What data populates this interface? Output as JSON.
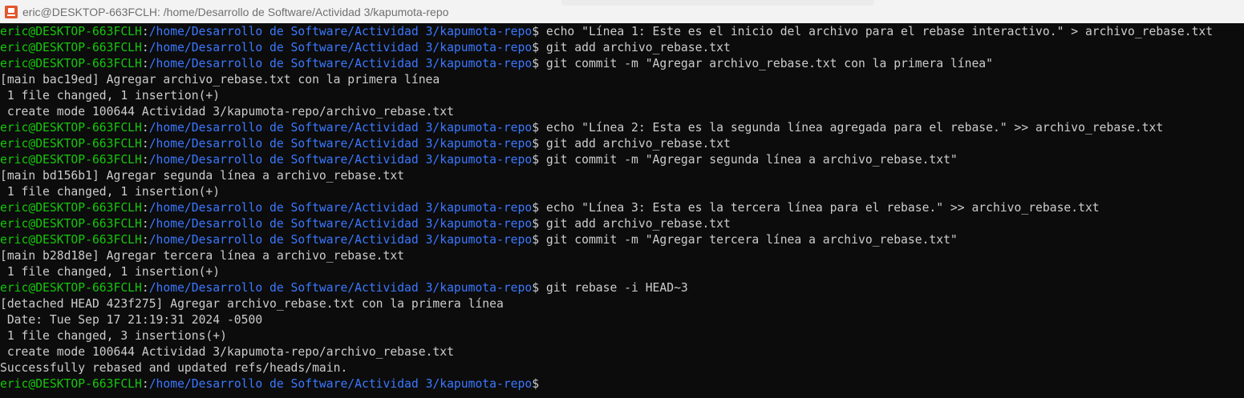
{
  "window": {
    "title": "eric@DESKTOP-663FCLH: /home/Desarrollo de Software/Actividad 3/kapumota-repo",
    "icon": "git-bash-icon"
  },
  "colors": {
    "background": "#0c0c0c",
    "text": "#cccccc",
    "user": "#16c60c",
    "path": "#3b78ff"
  },
  "terminal": {
    "lines": [
      {
        "type": "prompt",
        "user": "eric@DESKTOP-663FCLH",
        "sep": ":",
        "path": "/home/Desarrollo de Software/Actividad 3/kapumota-repo",
        "sign": "$",
        "cmd": " echo \"Línea 1: Este es el inicio del archivo para el rebase interactivo.\" > archivo_rebase.txt"
      },
      {
        "type": "prompt",
        "user": "eric@DESKTOP-663FCLH",
        "sep": ":",
        "path": "/home/Desarrollo de Software/Actividad 3/kapumota-repo",
        "sign": "$",
        "cmd": " git add archivo_rebase.txt"
      },
      {
        "type": "prompt",
        "user": "eric@DESKTOP-663FCLH",
        "sep": ":",
        "path": "/home/Desarrollo de Software/Actividad 3/kapumota-repo",
        "sign": "$",
        "cmd": " git commit -m \"Agregar archivo_rebase.txt con la primera línea\""
      },
      {
        "type": "output",
        "text": "[main bac19ed] Agregar archivo_rebase.txt con la primera línea"
      },
      {
        "type": "output",
        "text": " 1 file changed, 1 insertion(+)"
      },
      {
        "type": "output",
        "text": " create mode 100644 Actividad 3/kapumota-repo/archivo_rebase.txt"
      },
      {
        "type": "prompt",
        "user": "eric@DESKTOP-663FCLH",
        "sep": ":",
        "path": "/home/Desarrollo de Software/Actividad 3/kapumota-repo",
        "sign": "$",
        "cmd": " echo \"Línea 2: Esta es la segunda línea agregada para el rebase.\" >> archivo_rebase.txt"
      },
      {
        "type": "prompt",
        "user": "eric@DESKTOP-663FCLH",
        "sep": ":",
        "path": "/home/Desarrollo de Software/Actividad 3/kapumota-repo",
        "sign": "$",
        "cmd": " git add archivo_rebase.txt"
      },
      {
        "type": "prompt",
        "user": "eric@DESKTOP-663FCLH",
        "sep": ":",
        "path": "/home/Desarrollo de Software/Actividad 3/kapumota-repo",
        "sign": "$",
        "cmd": " git commit -m \"Agregar segunda línea a archivo_rebase.txt\""
      },
      {
        "type": "output",
        "text": "[main bd156b1] Agregar segunda línea a archivo_rebase.txt"
      },
      {
        "type": "output",
        "text": " 1 file changed, 1 insertion(+)"
      },
      {
        "type": "prompt",
        "user": "eric@DESKTOP-663FCLH",
        "sep": ":",
        "path": "/home/Desarrollo de Software/Actividad 3/kapumota-repo",
        "sign": "$",
        "cmd": " echo \"Línea 3: Esta es la tercera línea para el rebase.\" >> archivo_rebase.txt"
      },
      {
        "type": "prompt",
        "user": "eric@DESKTOP-663FCLH",
        "sep": ":",
        "path": "/home/Desarrollo de Software/Actividad 3/kapumota-repo",
        "sign": "$",
        "cmd": " git add archivo_rebase.txt"
      },
      {
        "type": "prompt",
        "user": "eric@DESKTOP-663FCLH",
        "sep": ":",
        "path": "/home/Desarrollo de Software/Actividad 3/kapumota-repo",
        "sign": "$",
        "cmd": " git commit -m \"Agregar tercera línea a archivo_rebase.txt\""
      },
      {
        "type": "output",
        "text": "[main b28d18e] Agregar tercera línea a archivo_rebase.txt"
      },
      {
        "type": "output",
        "text": " 1 file changed, 1 insertion(+)"
      },
      {
        "type": "prompt",
        "user": "eric@DESKTOP-663FCLH",
        "sep": ":",
        "path": "/home/Desarrollo de Software/Actividad 3/kapumota-repo",
        "sign": "$",
        "cmd": " git rebase -i HEAD~3"
      },
      {
        "type": "output",
        "text": "[detached HEAD 423f275] Agregar archivo_rebase.txt con la primera línea"
      },
      {
        "type": "output",
        "text": " Date: Tue Sep 17 21:19:31 2024 -0500"
      },
      {
        "type": "output",
        "text": " 1 file changed, 3 insertions(+)"
      },
      {
        "type": "output",
        "text": " create mode 100644 Actividad 3/kapumota-repo/archivo_rebase.txt"
      },
      {
        "type": "output",
        "text": "Successfully rebased and updated refs/heads/main."
      },
      {
        "type": "prompt",
        "user": "eric@DESKTOP-663FCLH",
        "sep": ":",
        "path": "/home/Desarrollo de Software/Actividad 3/kapumota-repo",
        "sign": "$",
        "cmd": ""
      }
    ]
  }
}
